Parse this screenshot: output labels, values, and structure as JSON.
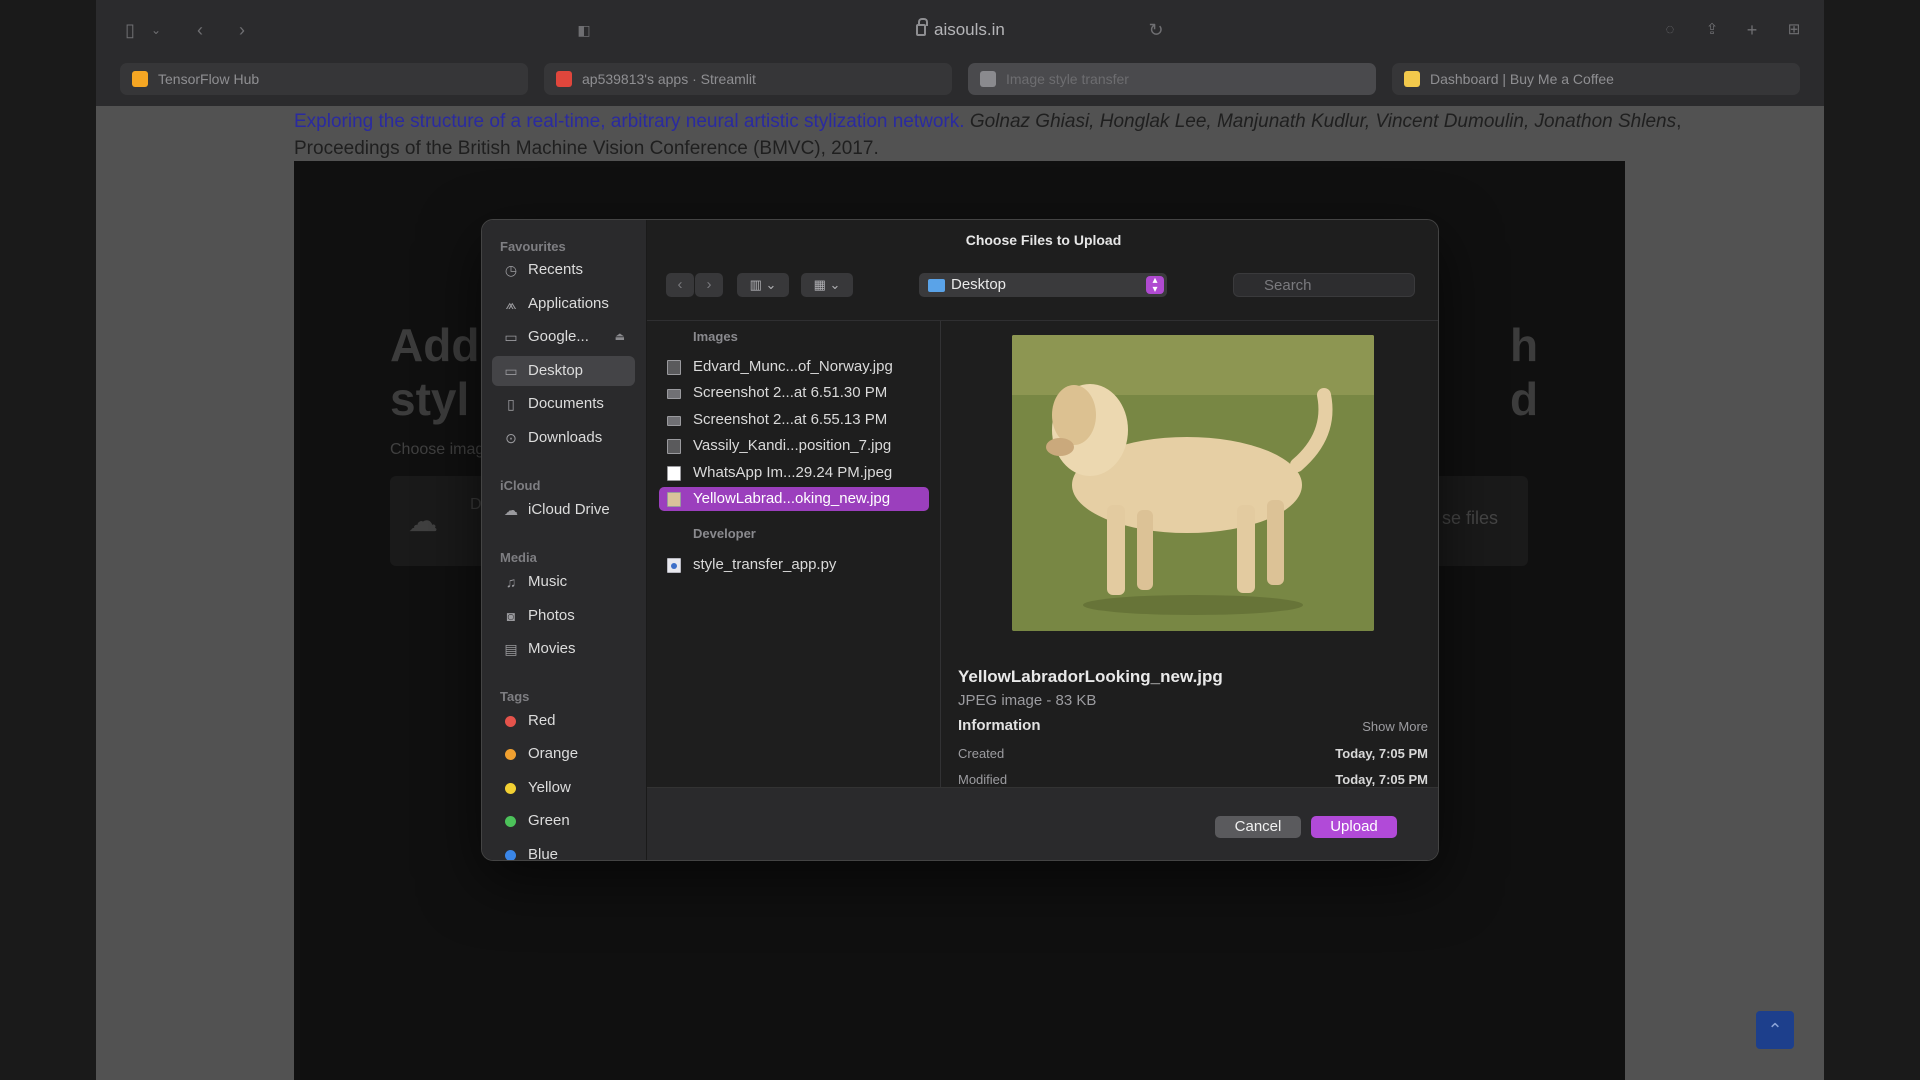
{
  "browser": {
    "url": "aisouls.in",
    "tabs": [
      {
        "label": "TensorFlow Hub",
        "color": "#f5a623"
      },
      {
        "label": "ap539813's apps · Streamlit",
        "color": "#e0463c"
      },
      {
        "label": "Image style transfer",
        "color": "#8a8a8e"
      },
      {
        "label": "Dashboard | Buy Me a Coffee",
        "color": "#f2c94c"
      }
    ]
  },
  "page": {
    "citation_link": "Exploring the structure of a real-time, arbitrary neural artistic stylization network.",
    "citation_authors": "Golnaz Ghiasi, Honglak Lee, Manjunath Kudlur, Vincent Dumoulin, Jonathon Shlens",
    "citation_venue": ", Proceedings of the British Machine Vision Conference (BMVC), 2017.",
    "heading_left_1": "Add",
    "heading_left_2": "styl",
    "heading_right_1": "h",
    "heading_right_2": "d",
    "choose_label": "Choose imag",
    "browse_label": "se files",
    "dropzone_initial": "D"
  },
  "dialog": {
    "title": "Choose Files to Upload",
    "location": "Desktop",
    "search_placeholder": "Search",
    "sidebar": {
      "favourites_header": "Favourites",
      "favourites": [
        "Recents",
        "Applications",
        "Google...",
        "Desktop",
        "Documents",
        "Downloads"
      ],
      "icloud_header": "iCloud",
      "icloud": [
        "iCloud Drive"
      ],
      "media_header": "Media",
      "media": [
        "Music",
        "Photos",
        "Movies"
      ],
      "tags_header": "Tags",
      "tags": [
        {
          "label": "Red",
          "color": "#e5534b"
        },
        {
          "label": "Orange",
          "color": "#f0a030"
        },
        {
          "label": "Yellow",
          "color": "#f2d033"
        },
        {
          "label": "Green",
          "color": "#4cc25a"
        },
        {
          "label": "Blue",
          "color": "#3a86e8"
        }
      ]
    },
    "groups": {
      "images": "Images",
      "developer": "Developer"
    },
    "files": [
      "Edvard_Munc...of_Norway.jpg",
      "Screenshot 2...at 6.51.30 PM",
      "Screenshot 2...at 6.55.13 PM",
      "Vassily_Kandi...position_7.jpg",
      "WhatsApp Im...29.24 PM.jpeg",
      "YellowLabrad...oking_new.jpg",
      "style_transfer_app.py"
    ],
    "preview": {
      "name": "YellowLabradorLooking_new.jpg",
      "kind": "JPEG image - 83 KB",
      "information": "Information",
      "show_more": "Show More",
      "created_label": "Created",
      "created_value": "Today, 7:05 PM",
      "modified_label": "Modified",
      "modified_value": "Today, 7:05 PM"
    },
    "cancel_label": "Cancel",
    "upload_label": "Upload"
  }
}
